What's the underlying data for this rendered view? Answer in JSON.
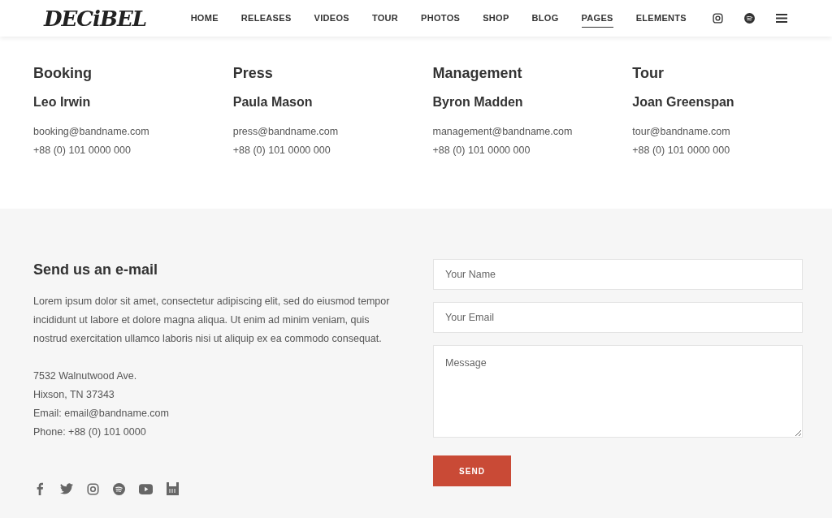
{
  "header": {
    "logo": "DECiBEL",
    "nav": [
      {
        "label": "HOME",
        "selected": false
      },
      {
        "label": "RELEASES",
        "selected": false
      },
      {
        "label": "VIDEOS",
        "selected": false
      },
      {
        "label": "TOUR",
        "selected": false
      },
      {
        "label": "PHOTOS",
        "selected": false
      },
      {
        "label": "SHOP",
        "selected": false
      },
      {
        "label": "BLOG",
        "selected": false
      },
      {
        "label": "PAGES",
        "selected": true
      },
      {
        "label": "ELEMENTS",
        "selected": false
      }
    ]
  },
  "contacts": [
    {
      "department": "Booking",
      "name": "Leo Irwin",
      "email": "booking@bandname.com",
      "phone": "+88 (0) 101 0000 000"
    },
    {
      "department": "Press",
      "name": "Paula Mason",
      "email": "press@bandname.com",
      "phone": "+88 (0) 101 0000 000"
    },
    {
      "department": "Management",
      "name": "Byron Madden",
      "email": "management@bandname.com",
      "phone": "+88 (0) 101 0000 000"
    },
    {
      "department": "Tour",
      "name": "Joan Greenspan",
      "email": "tour@bandname.com",
      "phone": "+88 (0) 101 0000 000"
    }
  ],
  "contact_section": {
    "title": "Send us an e-mail",
    "text": "Lorem ipsum dolor sit amet, consectetur adipiscing elit, sed do eiusmod tempor incididunt ut labore et dolore magna aliqua. Ut enim ad minim veniam, quis nostrud exercitation ullamco laboris nisi ut aliquip ex ea commodo consequat.",
    "address": [
      "7532 Walnutwood Ave.",
      "Hixson, TN 37343",
      "Email: email@bandname.com",
      "Phone: +88 (0) 101 0000"
    ],
    "form": {
      "name_placeholder": "Your Name",
      "email_placeholder": "Your Email",
      "message_placeholder": "Message",
      "button": "SEND"
    }
  }
}
